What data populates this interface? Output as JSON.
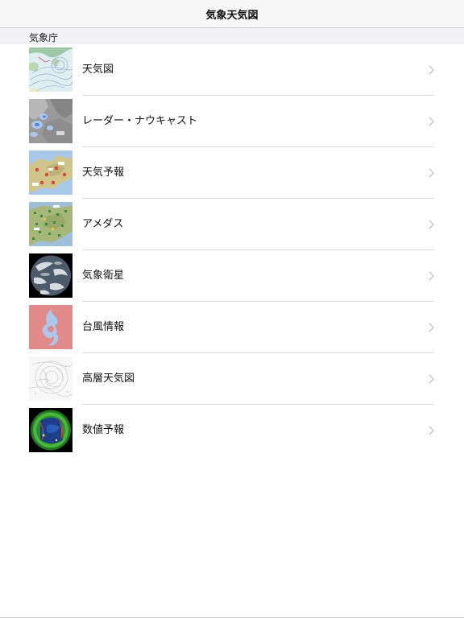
{
  "nav": {
    "title": "気象天気図"
  },
  "section": {
    "title": "気象庁"
  },
  "items": [
    {
      "label": "天気図",
      "icon": "weather-chart-thumbnail"
    },
    {
      "label": "レーダー・ナウキャスト",
      "icon": "radar-thumbnail"
    },
    {
      "label": "天気予報",
      "icon": "forecast-map-thumbnail"
    },
    {
      "label": "アメダス",
      "icon": "amedas-map-thumbnail"
    },
    {
      "label": "気象衛星",
      "icon": "satellite-earth-thumbnail"
    },
    {
      "label": "台風情報",
      "icon": "typhoon-symbol-thumbnail"
    },
    {
      "label": "高層天気図",
      "icon": "upper-air-chart-thumbnail"
    },
    {
      "label": "数値予報",
      "icon": "numerical-forecast-thumbnail"
    }
  ],
  "colors": {
    "nav_background": "#f7f7f7",
    "section_background": "#f2f2f4",
    "separator": "#dcdcdc",
    "chevron": "#c4c4c8",
    "typhoon_background": "#e08a8a",
    "typhoon_symbol": "#a9c8ec"
  }
}
